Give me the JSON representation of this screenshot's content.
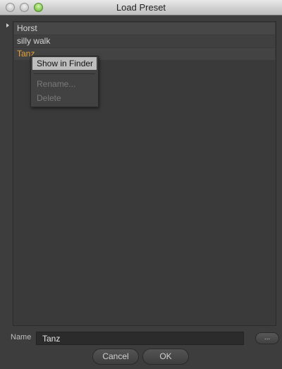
{
  "window": {
    "title": "Load Preset"
  },
  "presets": [
    "Horst",
    "silly walk",
    "Tanz"
  ],
  "context_menu": {
    "items": [
      "Show in Finder",
      "Rename...",
      "Delete"
    ]
  },
  "name_field": {
    "label": "Name",
    "value": "Tanz"
  },
  "browse_button": {
    "label": "..."
  },
  "buttons": {
    "cancel": "Cancel",
    "ok": "OK"
  },
  "colors": {
    "selected_text": "#e9a33a",
    "menu_highlight": "#bdbdbd"
  }
}
